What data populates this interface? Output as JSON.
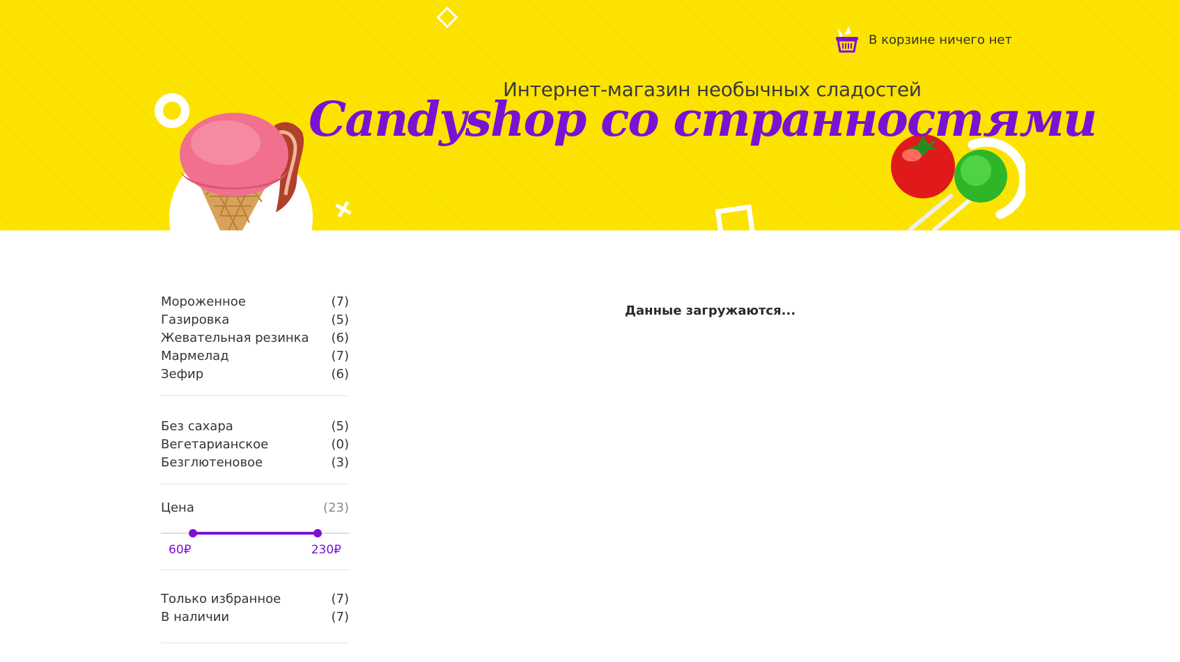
{
  "header": {
    "subtitle": "Интернет-магазин необычных сладостей",
    "brand_title": "Candyshop со странностями",
    "cart_text": "В корзине ничего нет",
    "cart_icon": "basket-icon",
    "background_color": "#fde400",
    "accent_color": "#7a12d4"
  },
  "filters": {
    "categories": [
      {
        "label": "Мороженное",
        "count": "(7)"
      },
      {
        "label": "Газировка",
        "count": "(5)"
      },
      {
        "label": "Жевательная резинка",
        "count": "(6)"
      },
      {
        "label": "Мармелад",
        "count": "(7)"
      },
      {
        "label": "Зефир",
        "count": "(6)"
      }
    ],
    "diet": [
      {
        "label": "Без сахара",
        "count": "(5)"
      },
      {
        "label": "Вегетарианское",
        "count": "(0)"
      },
      {
        "label": "Безглютеновое",
        "count": "(3)"
      }
    ],
    "price": {
      "label": "Цена",
      "count": "(23)",
      "min_label": "60₽",
      "max_label": "230₽"
    },
    "other": [
      {
        "label": "Только избранное",
        "count": "(7)"
      },
      {
        "label": "В наличии",
        "count": "(7)"
      }
    ]
  },
  "main": {
    "loading_text": "Данные загружаются..."
  }
}
